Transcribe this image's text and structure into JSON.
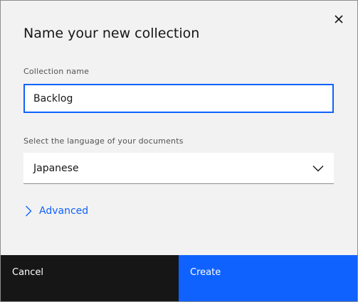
{
  "modal": {
    "title": "Name your new collection"
  },
  "collection_name": {
    "label": "Collection name",
    "value": "Backlog"
  },
  "language": {
    "label": "Select the language of your documents",
    "selected": "Japanese"
  },
  "advanced": {
    "label": "Advanced"
  },
  "footer": {
    "cancel_label": "Cancel",
    "create_label": "Create"
  },
  "icons": {
    "close": "close-icon",
    "dropdown": "chevron-down-icon",
    "advanced": "chevron-right-icon"
  },
  "colors": {
    "accent": "#0f62fe",
    "modal_bg": "#f2f2f2",
    "cancel_bg": "#161616"
  }
}
